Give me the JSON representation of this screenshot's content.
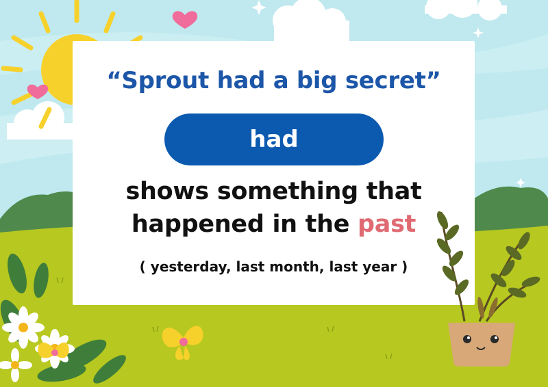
{
  "card": {
    "quote": "“Sprout had a big secret”",
    "highlight": "had",
    "explanation_line1": "shows something that",
    "explanation_line2_prefix": "happened in the ",
    "explanation_line2_emphasis": "past",
    "examples": "( yesterday, last month, last year )"
  },
  "colors": {
    "quote_blue": "#1c56a8",
    "pill_blue": "#0b5ab0",
    "emphasis_pink": "#e06a72",
    "sky": "#bfe9ef",
    "grass": "#b7c820"
  },
  "decorations": {
    "icons": [
      "sun-icon",
      "cloud-icon",
      "heart-icon",
      "sparkle-icon",
      "bush-icon",
      "flower-icon",
      "butterfly-icon",
      "potted-plant-icon"
    ]
  }
}
